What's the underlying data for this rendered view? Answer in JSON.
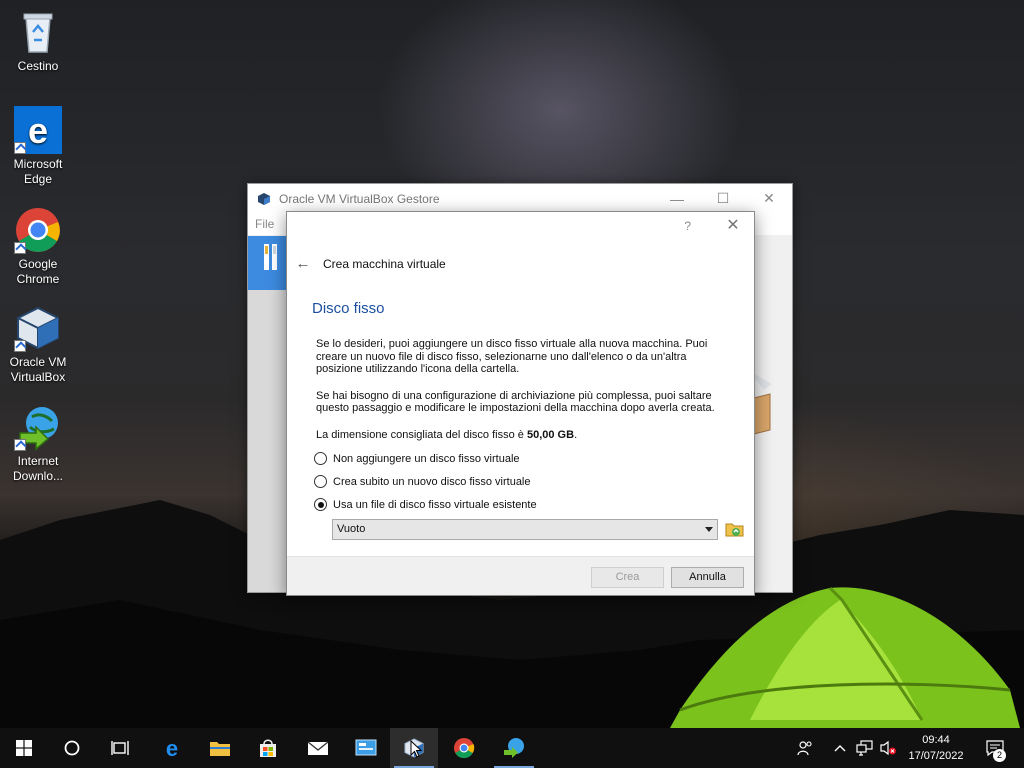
{
  "desktop": {
    "icons": [
      {
        "label": "Cestino",
        "icon": "recycle-bin-icon"
      },
      {
        "label": "Microsoft Edge",
        "icon": "edge-icon"
      },
      {
        "label": "Google Chrome",
        "icon": "chrome-icon"
      },
      {
        "label": "Oracle VM VirtualBox",
        "icon": "virtualbox-icon"
      },
      {
        "label": "Internet Downlo...",
        "icon": "internet-download-manager-icon"
      }
    ]
  },
  "vbox_window": {
    "title": "Oracle VM VirtualBox Gestore",
    "menu_file": "File",
    "controls": {
      "minimize": "—",
      "maximize": "☐",
      "close": "✕"
    }
  },
  "dialog": {
    "help": "?",
    "close": "✕",
    "back": "←",
    "wizard_title": "Crea macchina virtuale",
    "heading": "Disco fisso",
    "paragraph1": "Se lo desideri, puoi aggiungere un disco fisso virtuale alla nuova macchina. Puoi creare un nuovo file di disco fisso, selezionarne uno dall'elenco o da un'altra posizione utilizzando l'icona della cartella.",
    "paragraph2": "Se hai bisogno di una configurazione di archiviazione più complessa, puoi saltare questo passaggio e modificare le impostazioni della macchina dopo averla creata.",
    "recommended_prefix": "La dimensione consigliata del disco fisso è ",
    "recommended_size": "50,00 GB",
    "recommended_suffix": ".",
    "options": [
      {
        "label": "Non aggiungere un disco fisso virtuale",
        "checked": false
      },
      {
        "label": "Crea subito un nuovo disco fisso virtuale",
        "checked": false
      },
      {
        "label": "Usa un file di disco fisso virtuale esistente",
        "checked": true
      }
    ],
    "disk_select_value": "Vuoto",
    "buttons": {
      "create": "Crea",
      "cancel": "Annulla"
    }
  },
  "taskbar": {
    "clock_time": "09:44",
    "clock_date": "17/07/2022",
    "notification_count": "2",
    "accent": "#7aa8de"
  }
}
